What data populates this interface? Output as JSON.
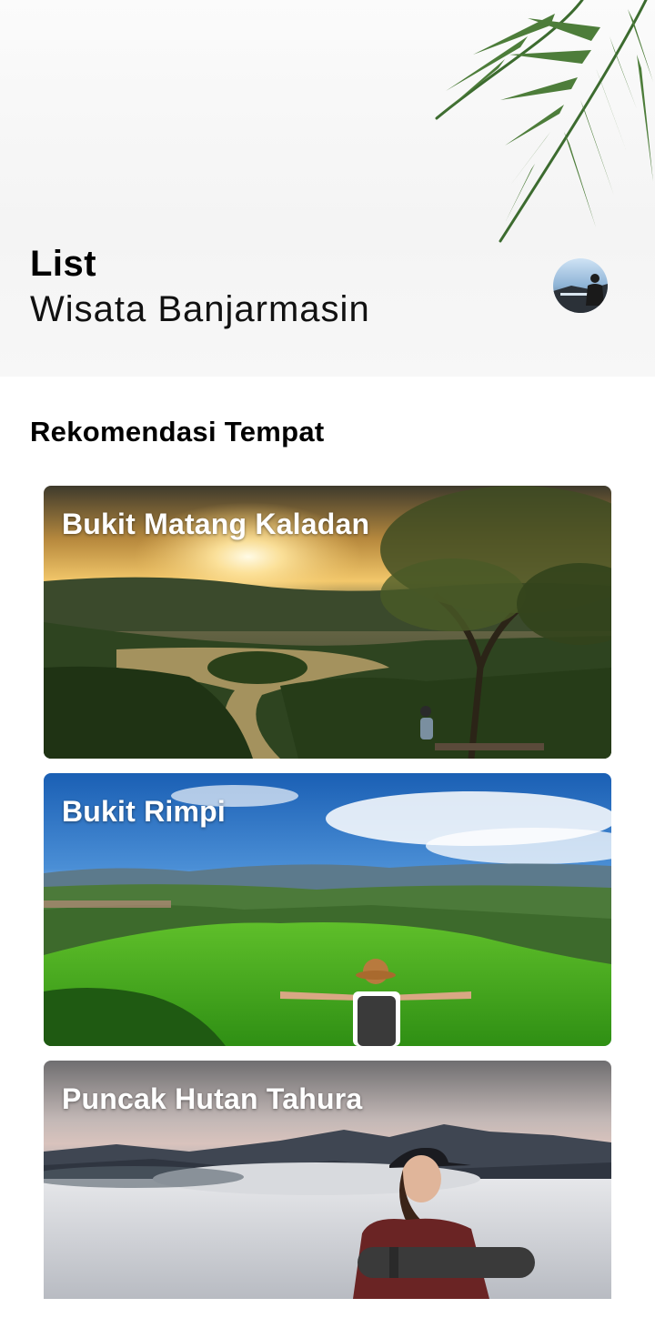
{
  "header": {
    "title_bold": "List",
    "title_light": "Wisata Banjarmasin",
    "avatar_icon": "profile-photo"
  },
  "section": {
    "title": "Rekomendasi Tempat"
  },
  "places": [
    {
      "name": "Bukit Matang Kaladan"
    },
    {
      "name": "Bukit Rimpi"
    },
    {
      "name": "Puncak Hutan Tahura"
    }
  ]
}
